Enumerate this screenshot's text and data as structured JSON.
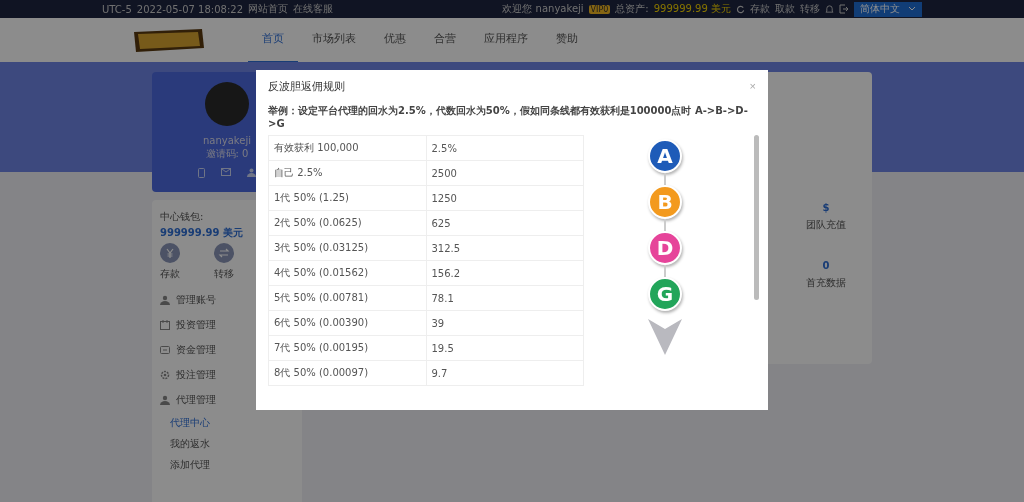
{
  "top_bar": {
    "timezone": "UTC-5",
    "datetime": "2022-05-07 18:08:22",
    "links": [
      "网站首页",
      "在线客服"
    ],
    "welcome": "欢迎您 nanyakeji",
    "vip_badge": "VIP0",
    "assets_label": "总资产:",
    "assets_value": "999999.99 美元",
    "actions": [
      "存款",
      "取款",
      "转移"
    ],
    "language": "简体中文"
  },
  "nav": {
    "items": [
      {
        "label": "首页",
        "selected": true
      },
      {
        "label": "市场列表",
        "selected": false
      },
      {
        "label": "优惠",
        "selected": false
      },
      {
        "label": "合营",
        "selected": false
      },
      {
        "label": "应用程序",
        "selected": false
      },
      {
        "label": "赞助",
        "selected": false
      }
    ]
  },
  "profile": {
    "username": "nanyakeji",
    "invite": "邀请码: 0"
  },
  "wallet": {
    "label": "中心钱包:",
    "value": "999999.99 美元",
    "actions": [
      {
        "label": "存款"
      },
      {
        "label": "转移"
      }
    ]
  },
  "sidebar": {
    "items": [
      {
        "label": "管理账号"
      },
      {
        "label": "投资管理"
      },
      {
        "label": "资金管理"
      },
      {
        "label": "投注管理"
      },
      {
        "label": "代理管理",
        "children": [
          {
            "label": "代理中心",
            "selected": true
          },
          {
            "label": "我的返水",
            "selected": false
          },
          {
            "label": "添加代理",
            "selected": false
          }
        ]
      }
    ]
  },
  "stats": [
    {
      "value": "$",
      "label": "团队充值"
    },
    {
      "value": "0",
      "label": "首充数据"
    }
  ],
  "dialog": {
    "title": "反波胆返佣规则",
    "close": "×",
    "example": "举例：设定平台代理的回水为2.5%，代数回水为50%，假如同条线都有效获利是100000点时 A->B->D->G",
    "rows": [
      [
        "有效获利 100,000",
        "2.5%"
      ],
      [
        "自己 2.5%",
        "2500"
      ],
      [
        "1代 50% (1.25)",
        "1250"
      ],
      [
        "2代 50% (0.0625)",
        "625"
      ],
      [
        "3代 50% (0.03125)",
        "312.5"
      ],
      [
        "4代 50% (0.01562)",
        "156.2"
      ],
      [
        "5代 50% (0.00781)",
        "78.1"
      ],
      [
        "6代 50% (0.00390)",
        "39"
      ],
      [
        "7代 50% (0.00195)",
        "19.5"
      ],
      [
        "8代 50% (0.00097)",
        "9.7"
      ]
    ],
    "chain": [
      {
        "letter": "A",
        "color": "#1e5bb8"
      },
      {
        "letter": "B",
        "color": "#f39a1e"
      },
      {
        "letter": "D",
        "color": "#e6449a"
      },
      {
        "letter": "G",
        "color": "#22a55a"
      }
    ]
  }
}
